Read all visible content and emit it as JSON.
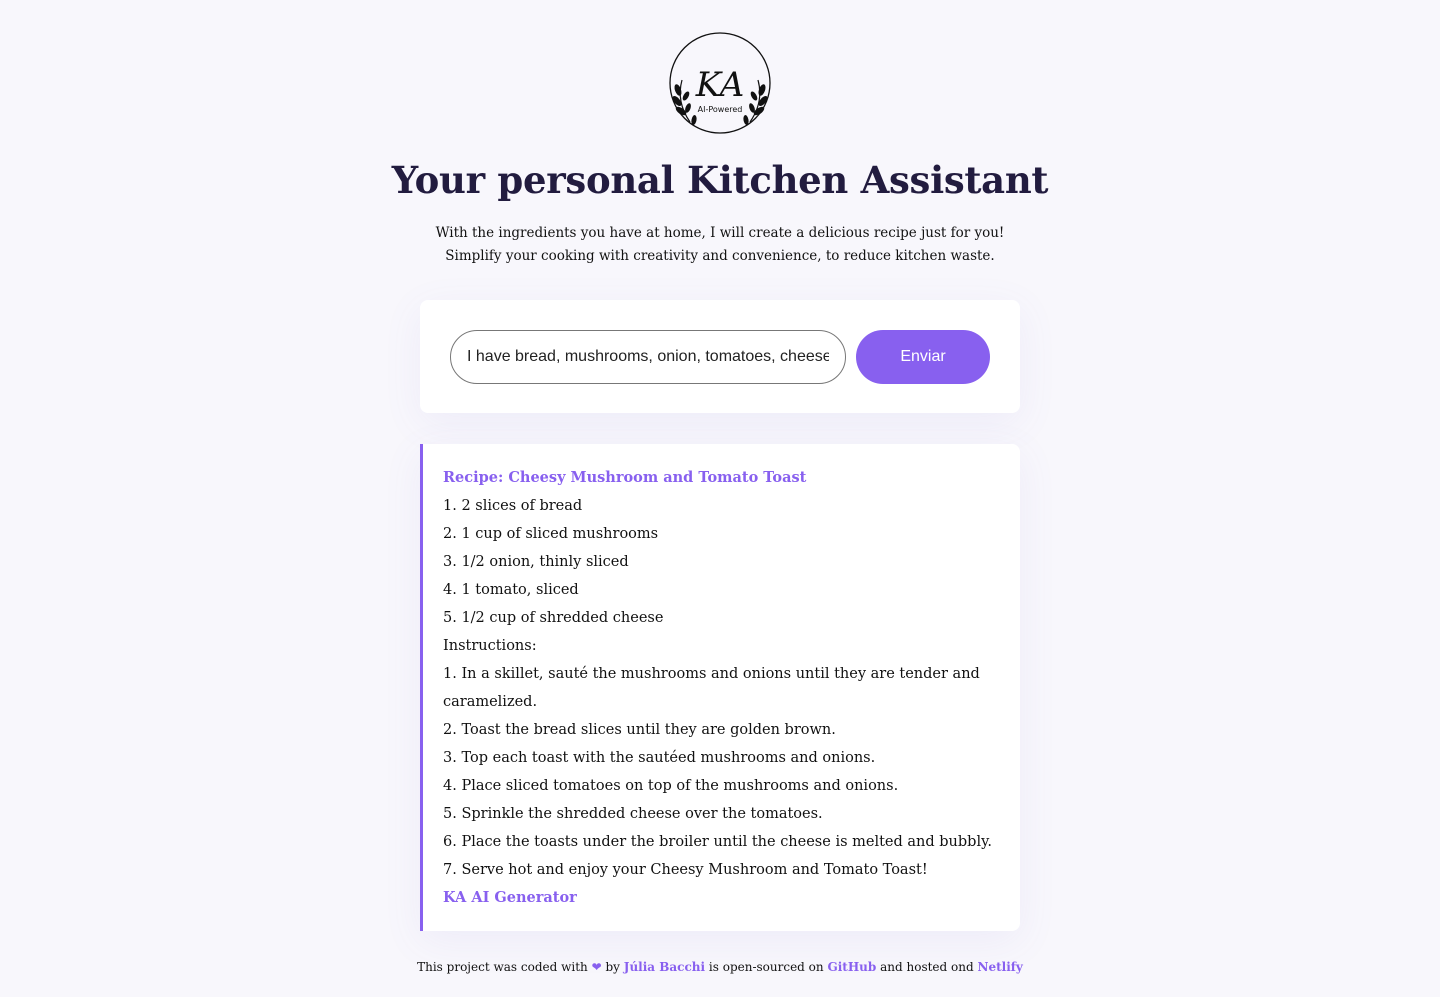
{
  "logo": {
    "monogram": "KA",
    "tagline": "AI-Powered"
  },
  "header": {
    "title": "Your personal Kitchen Assistant",
    "subtitle": "With the ingredients you have at home, I will create a delicious recipe just for you! Simplify your cooking with creativity and convenience, to reduce kitchen waste."
  },
  "form": {
    "input_value": "I have bread, mushrooms, onion, tomatoes, cheese",
    "submit_label": "Enviar"
  },
  "recipe": {
    "title": "Recipe: Cheesy Mushroom and Tomato Toast",
    "lines": [
      "1. 2 slices of bread",
      "2. 1 cup of sliced mushrooms",
      "3. 1/2 onion, thinly sliced",
      "4. 1 tomato, sliced",
      "5. 1/2 cup of shredded cheese",
      "Instructions:",
      "1. In a skillet, sauté the mushrooms and onions until they are tender and caramelized.",
      "2. Toast the bread slices until they are golden brown.",
      "3. Top each toast with the sautéed mushrooms and onions.",
      "4. Place sliced tomatoes on top of the mushrooms and onions.",
      "5. Sprinkle the shredded cheese over the tomatoes.",
      "6. Place the toasts under the broiler until the cheese is melted and bubbly.",
      "7. Serve hot and enjoy your Cheesy Mushroom and Tomato Toast!"
    ],
    "signature": "KA AI Generator"
  },
  "footer": {
    "prefix": "This project was coded with",
    "heart": "❤",
    "by": "by",
    "author": "Júlia Bacchi",
    "middle": "is open-sourced on",
    "github": "GitHub",
    "hosted": "and hosted ond",
    "netlify": "Netlify"
  },
  "colors": {
    "accent": "#8860ef",
    "title": "#221c3f",
    "background": "#f8f7fc"
  }
}
